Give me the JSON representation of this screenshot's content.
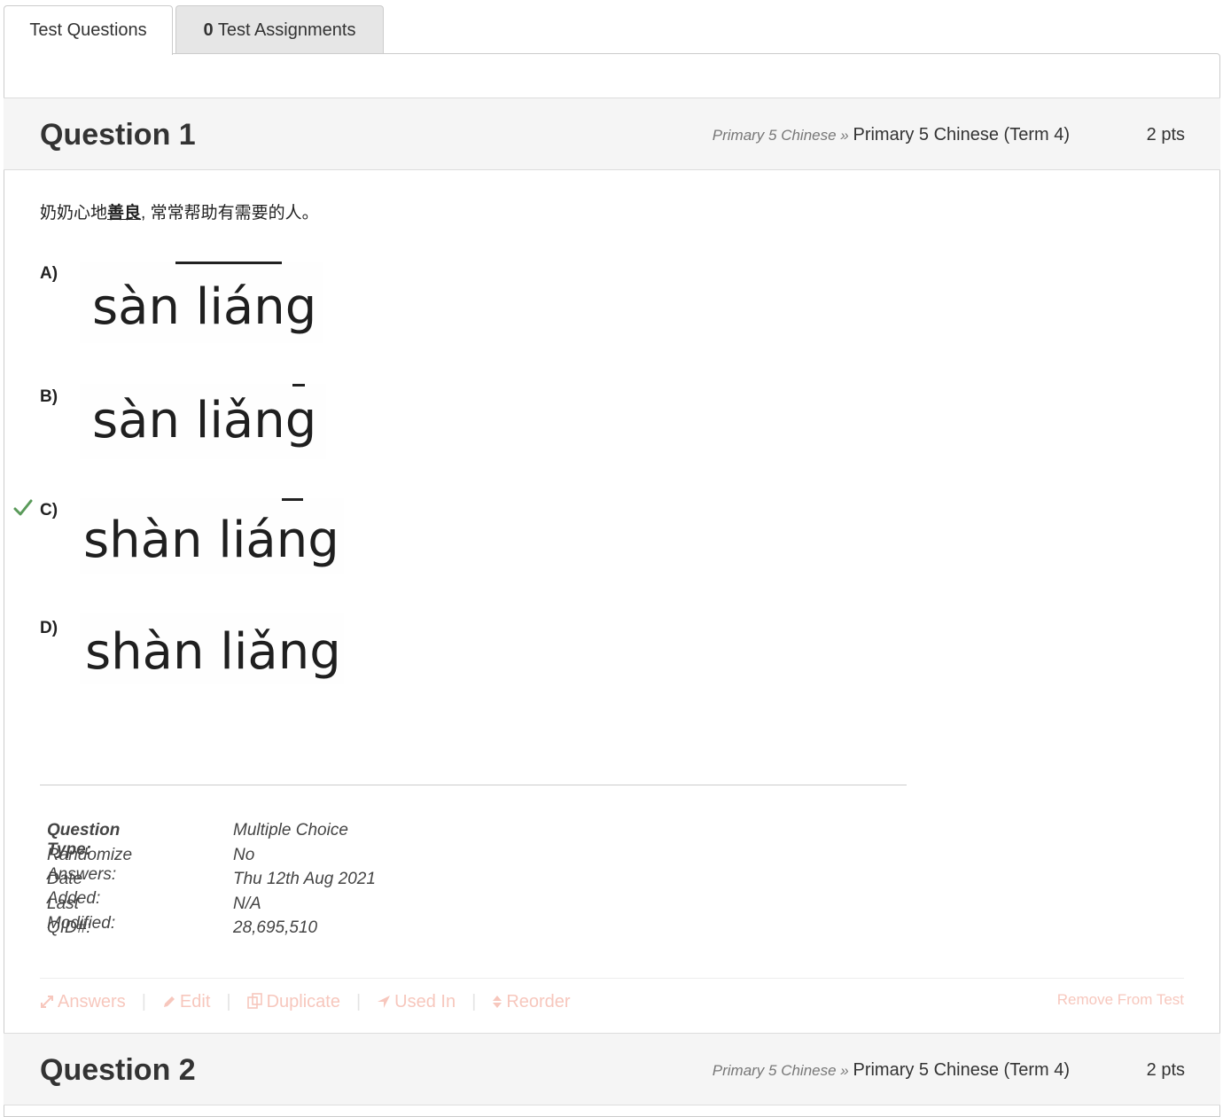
{
  "tabs": {
    "questions_label": "Test Questions",
    "assignments_count": "0",
    "assignments_label": " Test Assignments"
  },
  "questions": [
    {
      "title": "Question 1",
      "category_parent": "Primary 5 Chinese",
      "category_sep": " » ",
      "category": "Primary 5 Chinese (Term 4)",
      "points": "2 pts",
      "text_before": "奶奶心地",
      "text_underlined": "善良",
      "text_after": ", 常常帮助有需要的人。",
      "options": [
        {
          "label": "A)",
          "pinyin": "sàn liáng",
          "correct": false
        },
        {
          "label": "B)",
          "pinyin": "sàn liǎng",
          "correct": false
        },
        {
          "label": "C)",
          "pinyin": "shàn liáng",
          "correct": true
        },
        {
          "label": "D)",
          "pinyin": "shàn liǎng",
          "correct": false
        }
      ],
      "meta": {
        "type_label": "Question Type:",
        "type_value": "Multiple Choice",
        "randomize_label": "Randomize Answers:",
        "randomize_value": "No",
        "added_label": "Date Added:",
        "added_value": "Thu 12th Aug 2021",
        "modified_label": "Last Modified:",
        "modified_value": "N/A",
        "qid_label": "QID#:",
        "qid_value": "28,695,510"
      },
      "actions": {
        "answers": "Answers",
        "edit": "Edit",
        "duplicate": "Duplicate",
        "used_in": "Used In",
        "reorder": "Reorder",
        "remove": "Remove From Test"
      }
    },
    {
      "title": "Question 2",
      "category_parent": "Primary 5 Chinese",
      "category_sep": " » ",
      "category": "Primary 5 Chinese (Term 4)",
      "points": "2 pts"
    }
  ],
  "colors": {
    "correct_check": "#5a9a5a",
    "action_link": "#f7c7bd",
    "header_bg": "#f5f5f5"
  }
}
